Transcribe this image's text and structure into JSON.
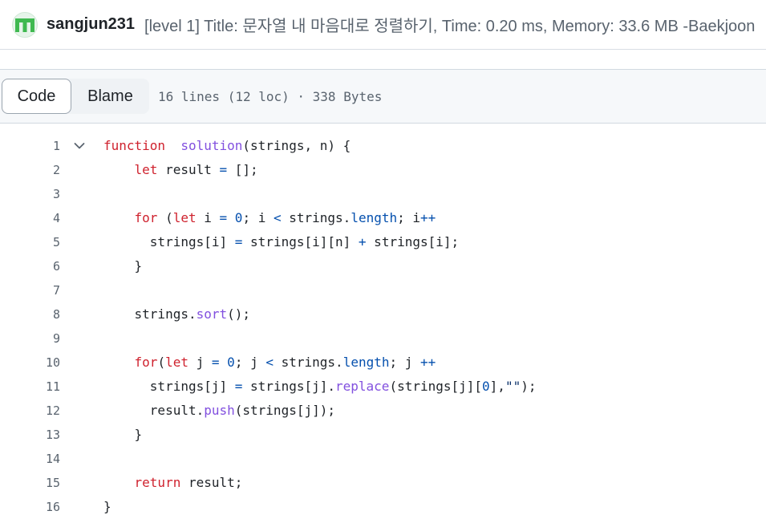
{
  "commit": {
    "author": "sangjun231",
    "message": "[level 1] Title: 문자열 내 마음대로 정렬하기, Time: 0.20 ms, Memory: 33.6 MB -Baekjoon"
  },
  "file_header": {
    "code_tab": "Code",
    "blame_tab": "Blame",
    "info": "16 lines (12 loc) · 338 Bytes"
  },
  "code": {
    "lines": [
      {
        "n": "1",
        "tokens": [
          [
            "kw",
            "function"
          ],
          [
            "",
            "  "
          ],
          [
            "fn",
            "solution"
          ],
          [
            "",
            "(strings, n) {"
          ]
        ]
      },
      {
        "n": "2",
        "tokens": [
          [
            "",
            "    "
          ],
          [
            "kw",
            "let"
          ],
          [
            "",
            " result "
          ],
          [
            "op",
            "="
          ],
          [
            "",
            " [];"
          ]
        ]
      },
      {
        "n": "3",
        "tokens": []
      },
      {
        "n": "4",
        "tokens": [
          [
            "",
            "    "
          ],
          [
            "kw",
            "for"
          ],
          [
            "",
            " ("
          ],
          [
            "kw",
            "let"
          ],
          [
            "",
            " i "
          ],
          [
            "op",
            "="
          ],
          [
            "",
            " "
          ],
          [
            "num",
            "0"
          ],
          [
            "",
            "; i "
          ],
          [
            "op",
            "<"
          ],
          [
            "",
            " strings."
          ],
          [
            "prop",
            "length"
          ],
          [
            "",
            "; i"
          ],
          [
            "op",
            "++"
          ],
          [
            ") {"
          ]
        ]
      },
      {
        "n": "5",
        "tokens": [
          [
            "",
            "      strings[i] "
          ],
          [
            "op",
            "="
          ],
          [
            "",
            " strings[i][n] "
          ],
          [
            "op",
            "+"
          ],
          [
            "",
            " strings[i];"
          ]
        ]
      },
      {
        "n": "6",
        "tokens": [
          [
            "",
            "    }"
          ]
        ]
      },
      {
        "n": "7",
        "tokens": []
      },
      {
        "n": "8",
        "tokens": [
          [
            "",
            "    strings."
          ],
          [
            "fn",
            "sort"
          ],
          [
            "",
            "();"
          ]
        ]
      },
      {
        "n": "9",
        "tokens": []
      },
      {
        "n": "10",
        "tokens": [
          [
            "",
            "    "
          ],
          [
            "kw",
            "for"
          ],
          [
            "",
            "("
          ],
          [
            "kw",
            "let"
          ],
          [
            "",
            " j "
          ],
          [
            "op",
            "="
          ],
          [
            "",
            " "
          ],
          [
            "num",
            "0"
          ],
          [
            "",
            "; j "
          ],
          [
            "op",
            "<"
          ],
          [
            "",
            " strings."
          ],
          [
            "prop",
            "length"
          ],
          [
            "",
            "; j "
          ],
          [
            "op",
            "++"
          ],
          [
            ") {"
          ]
        ]
      },
      {
        "n": "11",
        "tokens": [
          [
            "",
            "      strings[j] "
          ],
          [
            "op",
            "="
          ],
          [
            "",
            " strings[j]."
          ],
          [
            "fn",
            "replace"
          ],
          [
            "",
            "(strings[j]["
          ],
          [
            "num",
            "0"
          ],
          [
            "",
            "],"
          ],
          [
            "str",
            "\"\""
          ],
          [
            "",
            ");"
          ]
        ]
      },
      {
        "n": "12",
        "tokens": [
          [
            "",
            "      result."
          ],
          [
            "fn",
            "push"
          ],
          [
            "",
            "(strings[j]);"
          ]
        ]
      },
      {
        "n": "13",
        "tokens": [
          [
            "",
            "    }"
          ]
        ]
      },
      {
        "n": "14",
        "tokens": []
      },
      {
        "n": "15",
        "tokens": [
          [
            "",
            "    "
          ],
          [
            "kw",
            "return"
          ],
          [
            "",
            " result;"
          ]
        ]
      },
      {
        "n": "16",
        "tokens": [
          [
            "",
            "}"
          ]
        ]
      }
    ]
  },
  "colors": {
    "avatar_green": "#3fb950",
    "keyword": "#cf222e",
    "function": "#8250df",
    "property": "#0550ae",
    "string": "#0a3069"
  }
}
